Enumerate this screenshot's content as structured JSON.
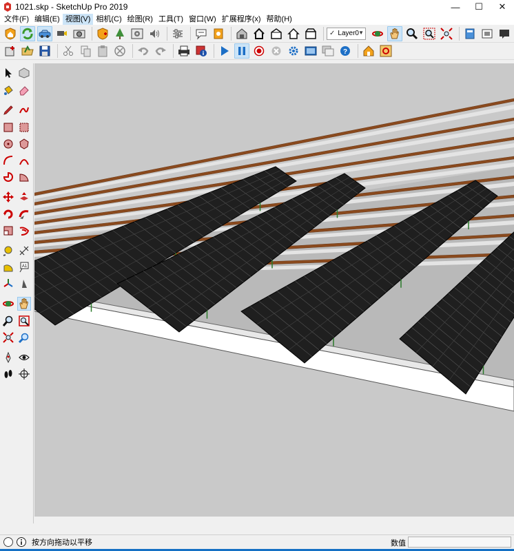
{
  "window": {
    "title": "1021.skp - SketchUp Pro 2019",
    "minimize_glyph": "—",
    "maximize_glyph": "☐",
    "close_glyph": "✕"
  },
  "menu": [
    "文件(F)",
    "编辑(E)",
    "视图(V)",
    "相机(C)",
    "绘图(R)",
    "工具(T)",
    "窗口(W)",
    "扩展程序(x)",
    "帮助(H)"
  ],
  "layer": {
    "current": "Layer0",
    "check": "✓"
  },
  "status": {
    "message": "按方向拖动以平移",
    "measurements_label": "数值",
    "measurements_value": ""
  },
  "colors": {
    "accent": "#1570c4",
    "viewport_background": "#c9c9c9",
    "solar_panel": "#1f1f1f",
    "steel_rail": "#8a4a1e"
  },
  "icons": {
    "toolbar_row1": [
      "house-shield-icon",
      "refresh-icon",
      "car-icon",
      "camera-drag-icon",
      "photo-icon",
      "model-shield-icon",
      "tree-icon",
      "photo-settings-icon",
      "speaker-icon",
      "sliders-icon",
      "comment-icon",
      "info-book-icon",
      "warehouse-icon",
      "house-front-icon",
      "house-icon",
      "house-outline-icon",
      "house-side-icon",
      "orbit-icon",
      "pan-icon",
      "zoom-icon",
      "zoom-window-icon",
      "zoom-extents-icon",
      "book-icon",
      "picture-icon",
      "message-icon"
    ],
    "toolbar_row2": [
      "add-location-icon",
      "open-folder-icon",
      "save-icon",
      "cut-icon",
      "copy-icon",
      "paste-icon",
      "erase-icon",
      "undo-icon",
      "redo-icon",
      "print-icon",
      "model-info-icon",
      "play-icon",
      "pause-icon",
      "record-icon",
      "stop-icon",
      "settings-icon",
      "scene-icon",
      "copy-scene-icon",
      "help-icon",
      "scene-house-icon",
      "scene-target-icon"
    ],
    "left_tools": [
      "select-icon",
      "make-component-icon",
      "paint-bucket-icon",
      "eraser-icon",
      "pencil-icon",
      "freehand-icon",
      "rectangle-icon",
      "rotated-rectangle-icon",
      "circle-icon",
      "polygon-icon",
      "arc-icon",
      "three-point-arc-icon",
      "pie-icon",
      "sector-icon",
      "move-icon",
      "push-pull-icon",
      "rotate-icon",
      "follow-me-icon",
      "scale-icon",
      "offset-icon",
      "tape-measure-icon",
      "text-icon",
      "protractor-icon",
      "3d-text-icon",
      "axes-icon",
      "section-plane-icon",
      "orbit-icon",
      "pan-icon",
      "zoom-icon",
      "zoom-window-icon",
      "zoom-extents-icon",
      "previous-view-icon",
      "position-camera-icon",
      "look-around-icon",
      "walk-icon",
      "section-icon"
    ]
  }
}
